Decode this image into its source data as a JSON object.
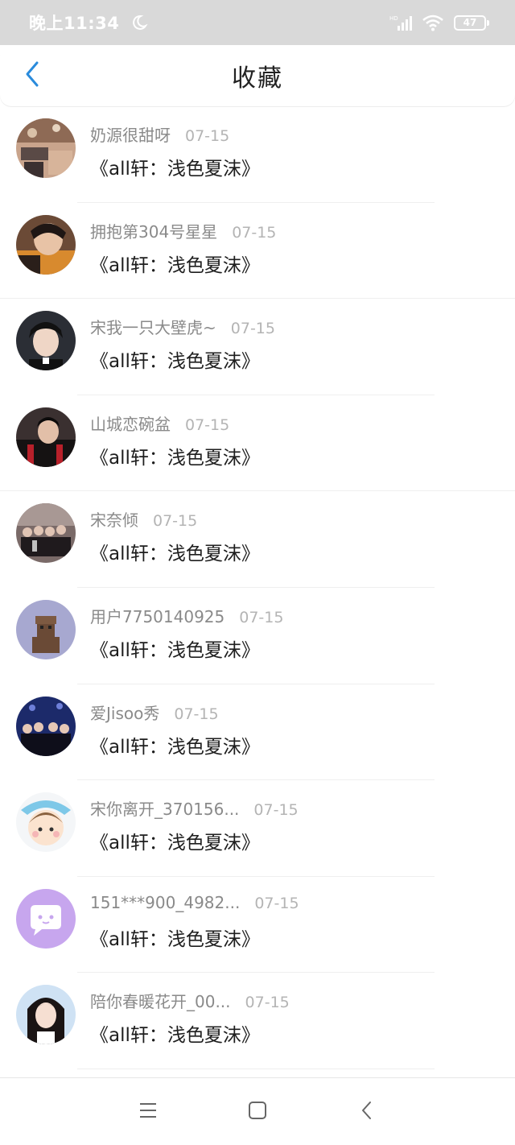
{
  "status_bar": {
    "time": "晚上11:34",
    "battery": "47"
  },
  "header": {
    "title": "收藏"
  },
  "colors": {
    "accent": "#2a8bdc",
    "status_bar_bg": "#d9d9d9"
  },
  "items": [
    {
      "username": "奶源很甜呀",
      "date": "07-15",
      "title": "《all轩：浅色夏沫》",
      "avatar": "photo-avatar"
    },
    {
      "username": "拥抱第304号星星",
      "date": "07-15",
      "title": "《all轩：浅色夏沫》",
      "avatar": "photo-avatar"
    },
    {
      "username": "宋我一只大壁虎~",
      "date": "07-15",
      "title": "《all轩：浅色夏沫》",
      "avatar": "photo-avatar"
    },
    {
      "username": "山城恋碗盆",
      "date": "07-15",
      "title": "《all轩：浅色夏沫》",
      "avatar": "photo-avatar"
    },
    {
      "username": "宋奈倾",
      "date": "07-15",
      "title": "《all轩：浅色夏沫》",
      "avatar": "photo-avatar"
    },
    {
      "username": "用户7750140925",
      "date": "07-15",
      "title": "《all轩：浅色夏沫》",
      "avatar": "photo-avatar"
    },
    {
      "username": "爱Jisoo秀",
      "date": "07-15",
      "title": "《all轩：浅色夏沫》",
      "avatar": "photo-avatar"
    },
    {
      "username": "宋你离开_370156...",
      "date": "07-15",
      "title": "《all轩：浅色夏沫》",
      "avatar": "cartoon-avatar"
    },
    {
      "username": "151***900_4982...",
      "date": "07-15",
      "title": "《all轩：浅色夏沫》",
      "avatar": "default-avatar"
    },
    {
      "username": "陪你春暖花开_00...",
      "date": "07-15",
      "title": "《all轩：浅色夏沫》",
      "avatar": "photo-avatar"
    }
  ],
  "nav": {
    "icons": [
      "menu-icon",
      "home-icon",
      "back-icon"
    ]
  }
}
